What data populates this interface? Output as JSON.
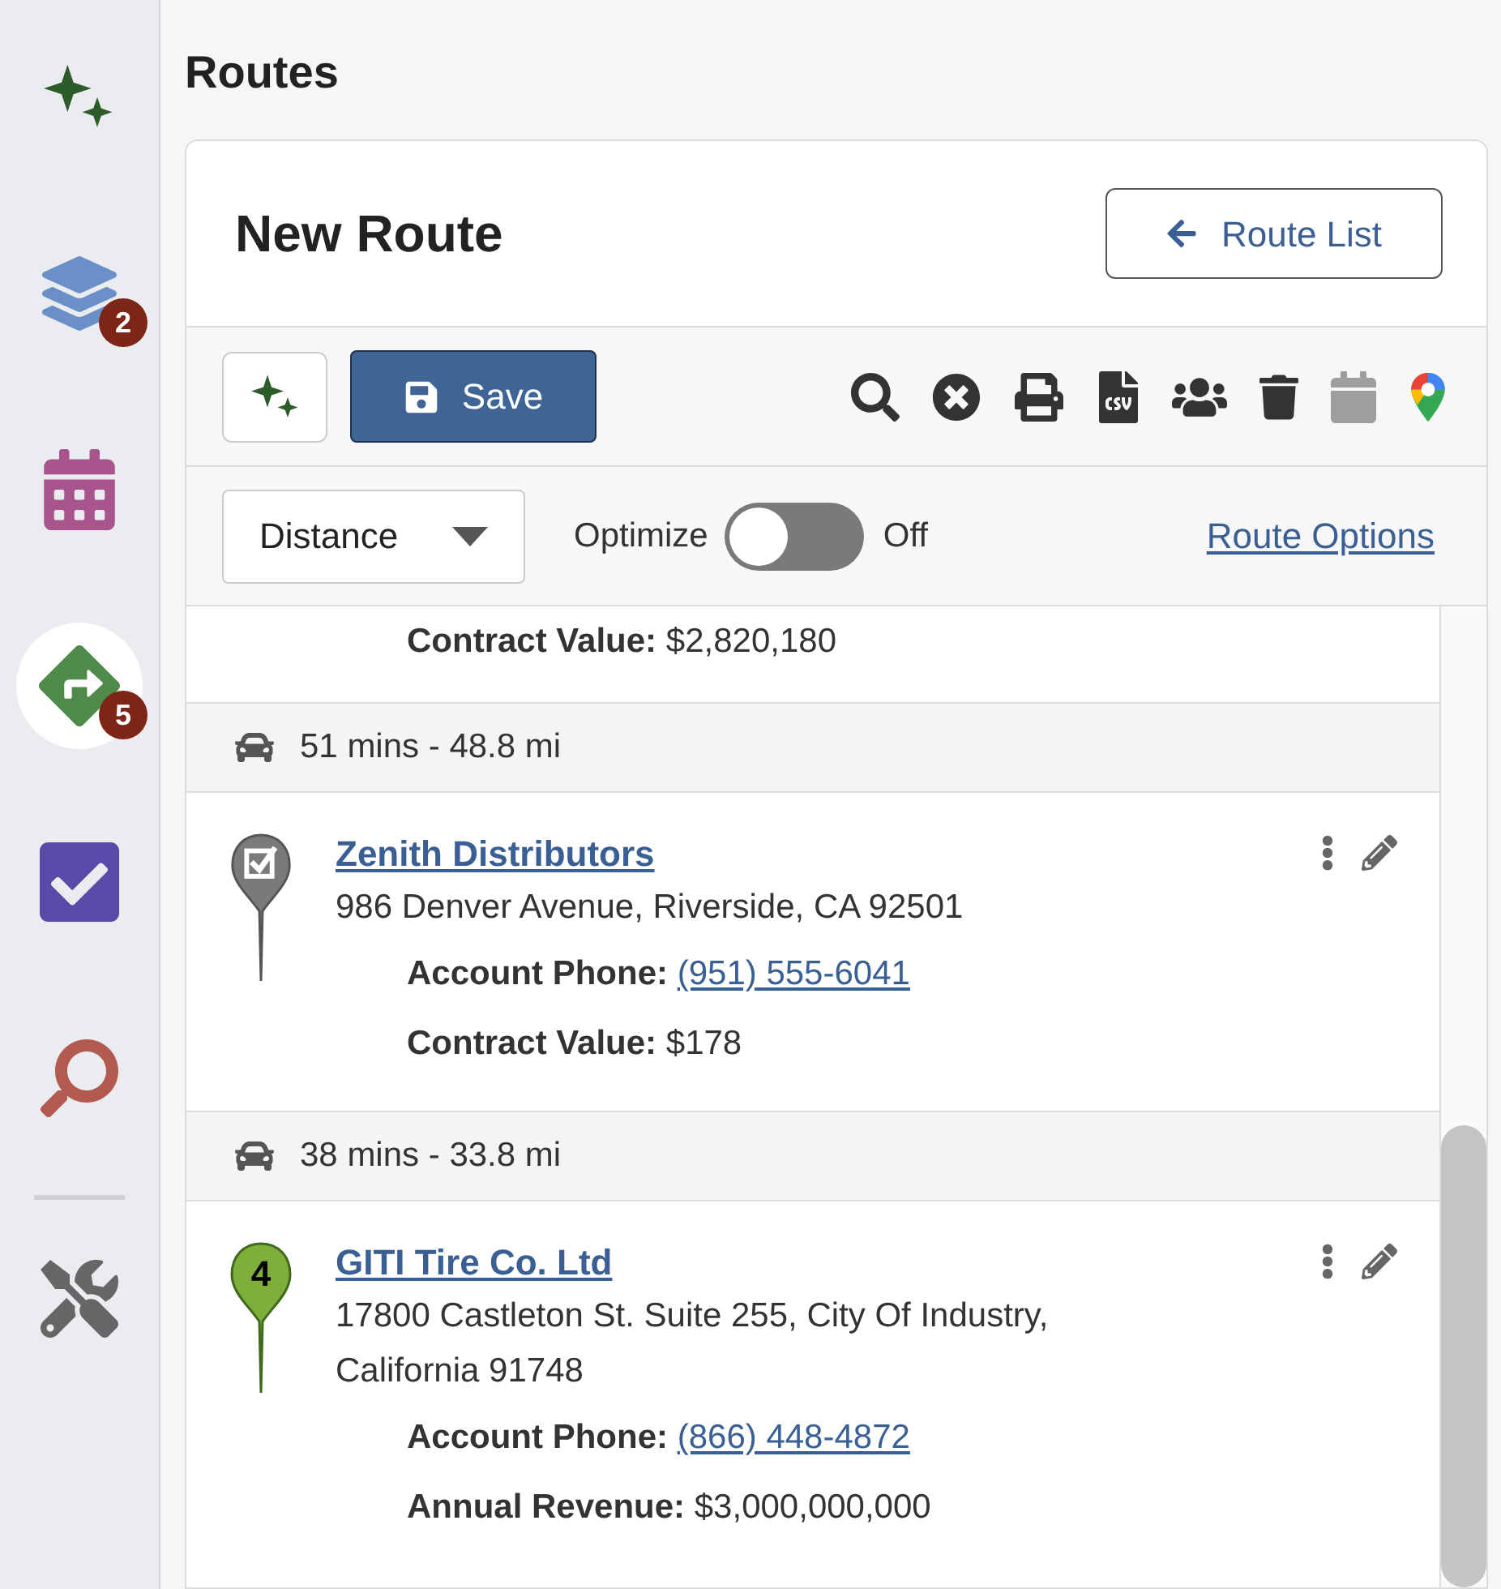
{
  "sidebar": {
    "items": [
      {
        "selected": false
      },
      {
        "selected": false,
        "badge": "2"
      },
      {
        "selected": false
      },
      {
        "selected": true,
        "badge": "5"
      },
      {
        "selected": false
      },
      {
        "selected": false
      },
      {
        "selected": false
      }
    ]
  },
  "page_title": "Routes",
  "route": {
    "title": "New Route",
    "back_button": "Route List"
  },
  "toolbar": {
    "save": "Save",
    "tools": [
      {
        "disabled": false
      },
      {
        "disabled": false
      },
      {
        "disabled": false
      },
      {
        "disabled": false
      },
      {
        "disabled": false
      },
      {
        "disabled": false
      },
      {
        "disabled": true
      },
      {
        "disabled": false
      }
    ]
  },
  "options": {
    "sort": "Distance",
    "optimize_label": "Optimize",
    "optimize": {
      "on": false,
      "label": "Off"
    },
    "link": "Route Options"
  },
  "stops": [
    {
      "kind": "partial",
      "fields": [
        {
          "label": "Contract Value:",
          "value": "$2,820,180",
          "kind": "text"
        }
      ]
    },
    {
      "kind": "drive",
      "text": "51 mins - 48.8 mi"
    },
    {
      "kind": "visited",
      "name": "Zenith Distributors",
      "address": "986 Denver Avenue, Riverside, CA 92501",
      "fields": [
        {
          "label": "Account Phone:",
          "value": "(951) 555-6041",
          "kind": "link"
        },
        {
          "label": "Contract Value:",
          "value": "$178",
          "kind": "text"
        }
      ]
    },
    {
      "kind": "drive",
      "text": "38 mins - 33.8 mi"
    },
    {
      "kind": "numbered",
      "number": "4",
      "name": "GITI Tire Co. Ltd",
      "address": "17800 Castleton St. Suite 255, City Of Industry, California 91748",
      "fields": [
        {
          "label": "Account Phone:",
          "value": "(866) 448-4872",
          "kind": "link"
        },
        {
          "label": "Annual Revenue:",
          "value": "$3,000,000,000",
          "kind": "text"
        }
      ]
    }
  ]
}
